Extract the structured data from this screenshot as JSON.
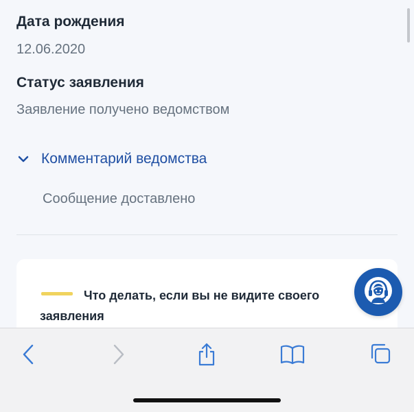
{
  "fields": {
    "birth_date": {
      "label": "Дата рождения",
      "value": "12.06.2020"
    },
    "status": {
      "label": "Статус заявления",
      "value": "Заявление получено ведомством"
    }
  },
  "comment": {
    "title": "Комментарий ведомства",
    "text": "Сообщение доставлено"
  },
  "help_card": {
    "text": "Что делать, если вы не видите своего заявления"
  },
  "colors": {
    "accent_blue": "#1f4fa3",
    "card_accent_yellow": "#f0d35e",
    "support_button": "#1c5bb0",
    "toolbar_icon": "#3a7bd5"
  },
  "icons": {
    "support": "operator-headset-icon",
    "comment_toggle": "chevron-down-icon",
    "toolbar": [
      "back-arrow-icon",
      "forward-arrow-icon",
      "share-icon",
      "bookmarks-icon",
      "tabs-icon"
    ]
  }
}
